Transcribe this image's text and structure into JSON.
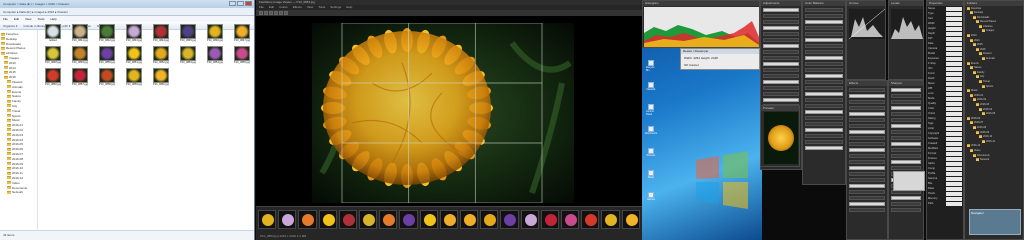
{
  "explorer": {
    "title": "Computer > Data (E:) > Images > 2016 > Flowers",
    "address": "Computer ▸ Data (E:) ▸ Images ▸ 2016 ▸ Flowers",
    "menu": [
      "File",
      "Edit",
      "View",
      "Tools",
      "Help"
    ],
    "toolbar": [
      "Organize ▾",
      "Include in library ▾",
      "Share with ▾",
      "Slide show",
      "New folder"
    ],
    "nav_items": [
      "Favorites",
      "Desktop",
      "Downloads",
      "Recent Places",
      "Libraries",
      "Images",
      "2013",
      "2014",
      "2015",
      "2016",
      "Flowers",
      "Animals",
      "Events",
      "Nature",
      "Family",
      "City",
      "Travel",
      "Sports",
      "Music",
      "2016-01",
      "2016-02",
      "2016-03",
      "2016-04",
      "2016-05",
      "2016-06",
      "2016-07",
      "2016-08",
      "2016-09",
      "2016-10",
      "2016-11",
      "2016-12",
      "Video",
      "Documents",
      "Network"
    ],
    "status": "43 items",
    "thumbnails": [
      {
        "label": "Edited",
        "color": "#d8dfe6"
      },
      {
        "label": "P10_0841.jpg",
        "color": "#c9b08a"
      },
      {
        "label": "P10_0842.jpg",
        "color": "#4c7a3a"
      },
      {
        "label": "P10_0843.jpg",
        "color": "#c9a7d8"
      },
      {
        "label": "P10_0844.jpg",
        "color": "#b0303a"
      },
      {
        "label": "P10_0845.jpg",
        "color": "#4f3f86"
      },
      {
        "label": "P10_0846.jpg",
        "color": "#e2b21f"
      },
      {
        "label": "P10_0847.jpg",
        "color": "#f0ad2a"
      },
      {
        "label": "P10_0848.jpg",
        "color": "#d9c53a"
      },
      {
        "label": "P10_0849.jpg",
        "color": "#c8812a"
      },
      {
        "label": "P10_0850.jpg",
        "color": "#6c3fa4"
      },
      {
        "label": "P10_0851.jpg",
        "color": "#f0c21a"
      },
      {
        "label": "P10_0852.jpg",
        "color": "#e4a81c"
      },
      {
        "label": "P10_0853.jpg",
        "color": "#d8b42a"
      },
      {
        "label": "P10_0854.jpg",
        "color": "#9a5ab8"
      },
      {
        "label": "P10_0855.jpg",
        "color": "#c94b8d"
      },
      {
        "label": "P10_0856.jpg",
        "color": "#d43a2a"
      },
      {
        "label": "P10_0857.jpg",
        "color": "#c4243a"
      },
      {
        "label": "P10_0858.jpg",
        "color": "#c44a24"
      },
      {
        "label": "P10_0859.jpg",
        "color": "#e2b41f"
      },
      {
        "label": "P10_0860.jpg",
        "color": "#f0b32a"
      }
    ]
  },
  "viewer": {
    "title": "FastStone Image Viewer — P10_0853.jpg",
    "menu": [
      "File",
      "Edit",
      "Colors",
      "Effects",
      "View",
      "Tools",
      "Settings",
      "Help"
    ],
    "film_label": "P10_0853.jpg  3264 x 2448  2.4 MB",
    "filmstrip": [
      "#e2b21f",
      "#c9a7d8",
      "#e47a2a",
      "#f0c21a",
      "#b0303a",
      "#d8b42a",
      "#e47a2a",
      "#6c3fa4",
      "#f0c21a",
      "#f0ad2a",
      "#f0ad2a",
      "#e4a81c",
      "#6c3fa4",
      "#c9a7d8",
      "#c4243a",
      "#c94b8d",
      "#d43a2a",
      "#e2b41f",
      "#f0b32a"
    ]
  },
  "desktop": {
    "icons": [
      "Computer",
      "Recycle Bin",
      "Network",
      "Control Panel",
      "Documents",
      "Pictures",
      "Music",
      "Games"
    ]
  },
  "panels": {
    "histogram": "Histogram",
    "dialog_title": "Resize / Resample",
    "dialog_line1": "Width: 3264  Height: 2448",
    "dialog_line2": "OK    Cancel",
    "tone_curve": "Curves",
    "levels": "Levels",
    "adjust": "Adjustments",
    "color": "Color Balance",
    "effects": "Effects",
    "sharpen": "Sharpen",
    "preview": "Preview",
    "properties": "Properties",
    "folders": "Folders",
    "navigator": "Navigator",
    "property_keys": [
      "Name",
      "Type",
      "Size",
      "Width",
      "Height",
      "Depth",
      "DPI",
      "Date",
      "Camera",
      "Model",
      "Exposure",
      "F-Stop",
      "ISO",
      "Focal",
      "Flash",
      "Meter",
      "WB",
      "Lens",
      "Mode",
      "Quality",
      "Color",
      "Orient",
      "Rating",
      "Tags",
      "Artist",
      "Copyright",
      "Software",
      "Created",
      "Modified",
      "Format",
      "Frames",
      "Alpha",
      "Comp",
      "Profile",
      "Gamma",
      "Bits",
      "Ratio",
      "Pixels",
      "Memory",
      "Path"
    ]
  },
  "colors": {
    "accent": "#3b77c9",
    "flower": "#f0b21c"
  }
}
